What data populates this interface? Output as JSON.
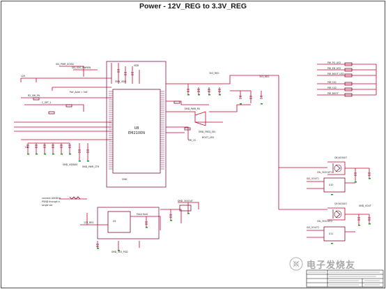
{
  "page": {
    "title": "Power - 12V_REG to 3.3V_REG"
  },
  "main_ic": {
    "refdes": "U8",
    "part": "EM2100N"
  },
  "watermark": {
    "text": "电子发烧友"
  },
  "colors": {
    "wire": "#c8002a",
    "part_outline": "#7a0f36",
    "ground": "#1a9a1a",
    "title_block": "#111111"
  }
}
